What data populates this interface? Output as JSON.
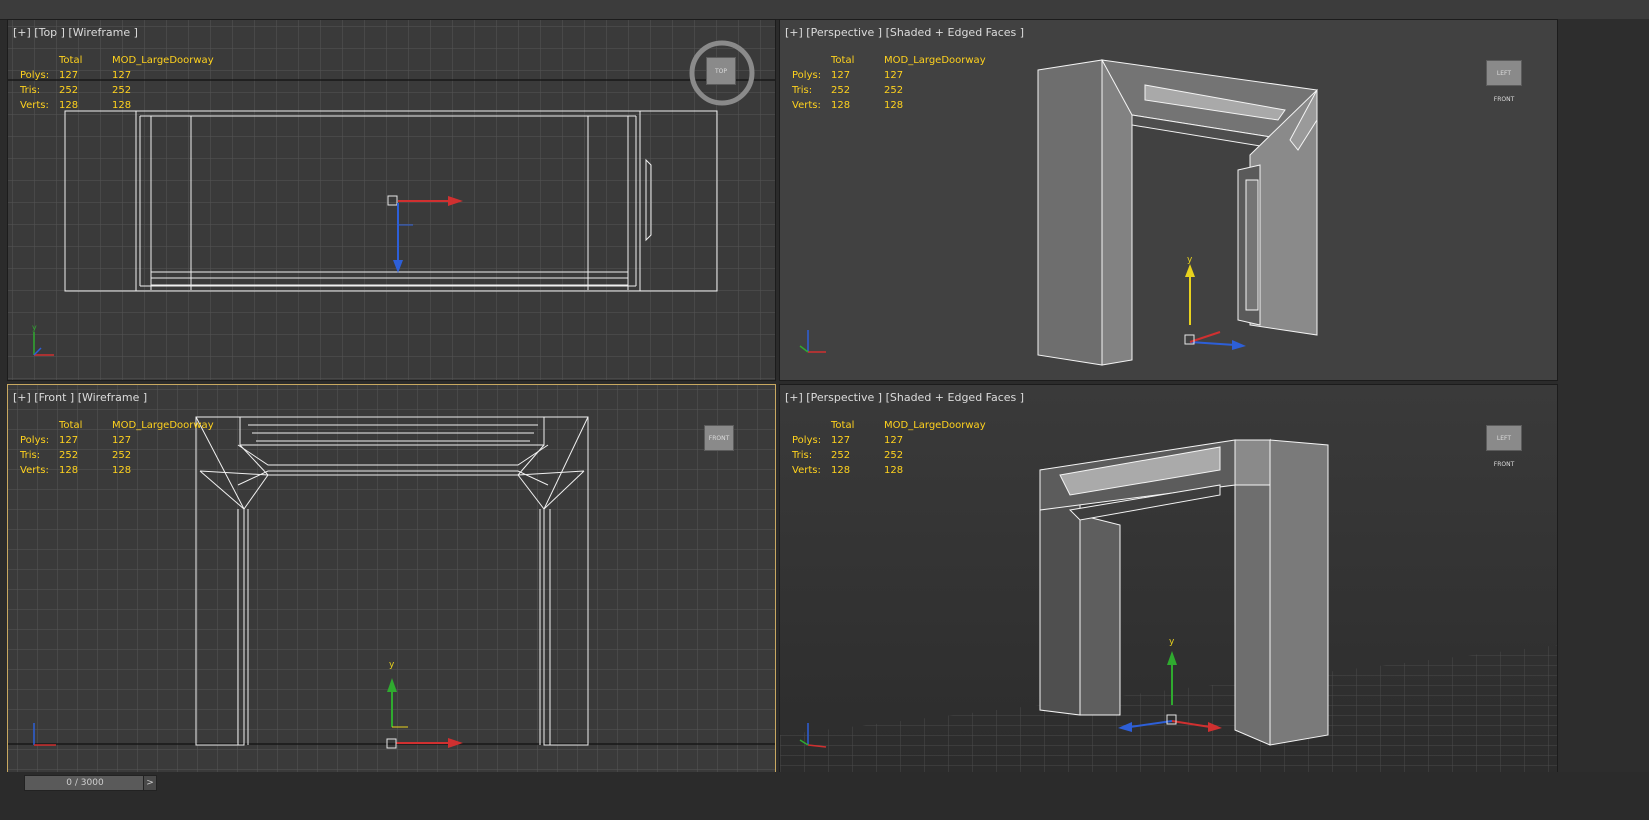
{
  "stats_header": {
    "col1": "Total",
    "col2": "MOD_LargeDoorway"
  },
  "stats_rows": [
    {
      "label": "Polys:",
      "total": "127",
      "obj": "127"
    },
    {
      "label": "Tris:",
      "total": "252",
      "obj": "252"
    },
    {
      "label": "Verts:",
      "total": "128",
      "obj": "128"
    }
  ],
  "viewports": {
    "top": {
      "label": "[+] [Top ] [Wireframe ]",
      "cube": "TOP"
    },
    "persp_top": {
      "label": "[+] [Perspective ] [Shaded + Edged Faces ]",
      "cube": "LEFT  FRONT"
    },
    "front": {
      "label": "[+] [Front ] [Wireframe ]",
      "cube": "FRONT"
    },
    "persp_bottom": {
      "label": "[+] [Perspective ] [Shaded + Edged Faces ]",
      "cube": "LEFT  FRONT"
    }
  },
  "axis_labels": {
    "x": "x",
    "y": "y",
    "z": "z"
  },
  "timeline": {
    "frame": "0 / 3000",
    "next": ">"
  },
  "colors": {
    "stats_text": "#ffd21e",
    "active_border": "#c8a860",
    "axis_x": "#d03030",
    "axis_y": "#e8d21e",
    "axis_z": "#2d5fd8",
    "gizmo_y": "#2faa2f"
  }
}
